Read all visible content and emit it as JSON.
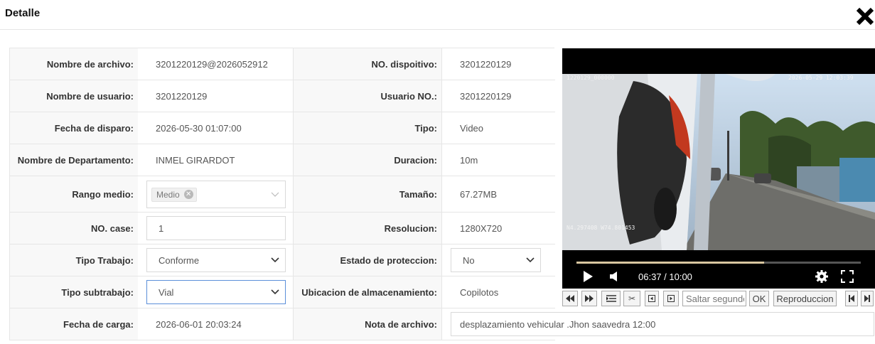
{
  "dialog": {
    "title": "Detalle",
    "close_icon": "close-icon"
  },
  "fields": {
    "nombre_archivo": {
      "label": "Nombre de archivo:",
      "value": "3201220129@2026052912"
    },
    "no_dispositivo": {
      "label": "NO. dispoitivo:",
      "value": "3201220129"
    },
    "nombre_usuario": {
      "label": "Nombre de usuario:",
      "value": "3201220129"
    },
    "usuario_no": {
      "label": "Usuario NO.:",
      "value": "3201220129"
    },
    "fecha_disparo": {
      "label": "Fecha de disparo:",
      "value": "2026-05-30 01:07:00"
    },
    "tipo": {
      "label": "Tipo:",
      "value": "Video"
    },
    "departamento": {
      "label": "Nombre de Departamento:",
      "value": "INMEL GIRARDOT"
    },
    "duracion": {
      "label": "Duracion:",
      "value": "10m"
    },
    "rango_medio": {
      "label": "Rango medio:",
      "tag": "Medio"
    },
    "tamano": {
      "label": "Tamaño:",
      "value": "67.27MB"
    },
    "no_case": {
      "label": "NO. case:",
      "value": "1"
    },
    "resolucion": {
      "label": "Resolucion:",
      "value": "1280X720"
    },
    "tipo_trabajo": {
      "label": "Tipo Trabajo:",
      "selected": "Conforme"
    },
    "estado_proteccion": {
      "label": "Estado de proteccion:",
      "selected": "No"
    },
    "tipo_subtrabajo": {
      "label": "Tipo subtrabajo:",
      "selected": "Vial"
    },
    "ubicacion": {
      "label": "Ubicacion de almacenamiento:",
      "value": "Copilotos"
    },
    "fecha_carga": {
      "label": "Fecha de carga:",
      "value": "2026-06-01 20:03:24"
    },
    "nota_archivo": {
      "label": "Nota de archivo:",
      "value": "desplazamiento vehicular .Jhon saavedra 12:00"
    }
  },
  "video": {
    "osd_id": "1220129_000000",
    "osd_datetime": "2026-05-29 12:03:39",
    "osd_gps": "N4.297408 W74.801453",
    "time": "06:37 / 10:00",
    "progress": 0.66,
    "icons": [
      "play-icon",
      "volume-icon",
      "settings-icon",
      "fullscreen-icon"
    ]
  },
  "toolbar": {
    "seek_placeholder": "Saltar segundos",
    "ok_label": "OK",
    "playback_label": "Reproduccion",
    "icons": [
      "rewind-icon",
      "fast-forward-icon",
      "list-icon",
      "clip-icon",
      "prev-frame-icon",
      "next-frame-icon",
      "first-icon",
      "last-icon"
    ]
  },
  "colors": {
    "label_bg": "#f8f8f8",
    "border": "#e6e6e6",
    "focus_border": "#5b8fd9"
  }
}
